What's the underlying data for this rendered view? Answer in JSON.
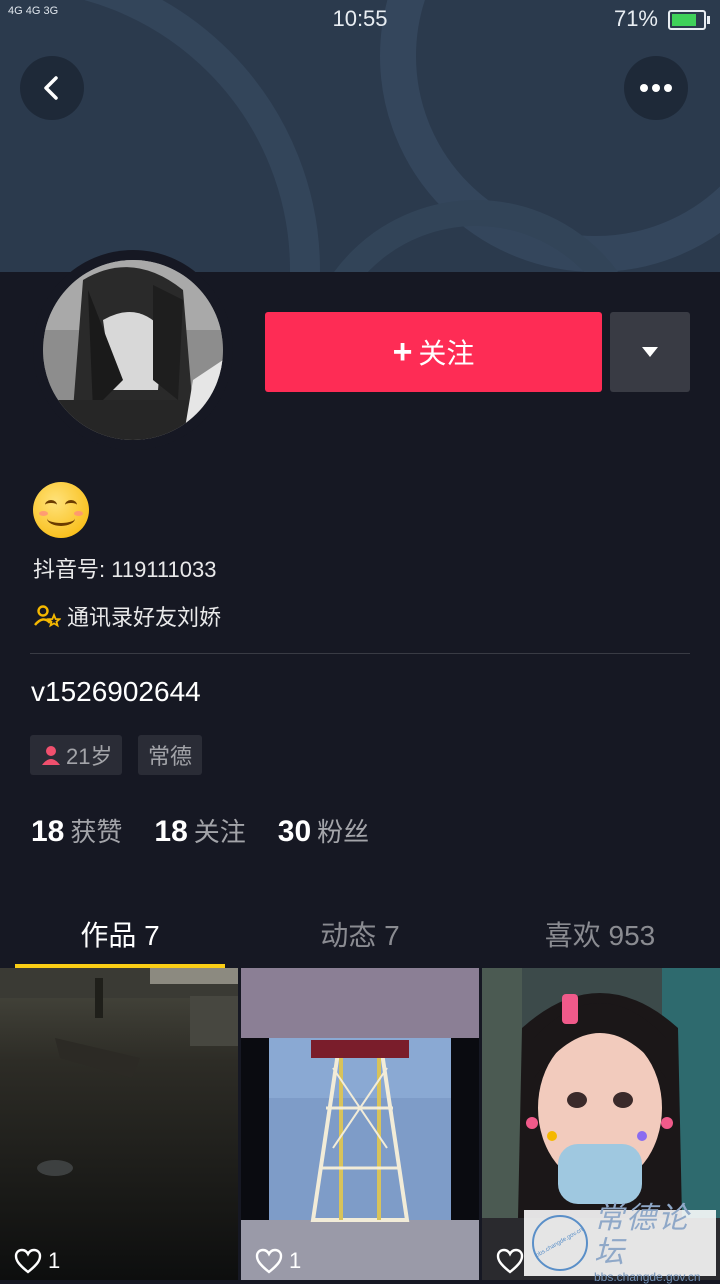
{
  "status_bar": {
    "signal": "4G 4G 3G",
    "time": "10:55",
    "battery": "71%"
  },
  "profile": {
    "douyin_id": "抖音号: 119111033",
    "friend_hint": "通讯录好友刘娇",
    "bio": "v1526902644",
    "tags": {
      "age": "21岁",
      "city": "常德"
    },
    "follow_button": "关注"
  },
  "stats": [
    {
      "num": "18",
      "label": "获赞"
    },
    {
      "num": "18",
      "label": "关注"
    },
    {
      "num": "30",
      "label": "粉丝"
    }
  ],
  "tabs": [
    {
      "label": "作品 7",
      "active": true
    },
    {
      "label": "动态 7",
      "active": false
    },
    {
      "label": "喜欢 953",
      "active": false
    }
  ],
  "videos": [
    {
      "likes": "1"
    },
    {
      "likes": "1"
    },
    {
      "likes": ""
    }
  ],
  "watermark": {
    "title": "常德论坛",
    "url": "bbs.changde.gov.cn",
    "seal_text": "bbs.changde.gov.cn"
  },
  "colors": {
    "accent": "#fe2c55",
    "background": "#161823",
    "tab_indicator": "#face15"
  },
  "icons": [
    "back-arrow-icon",
    "more-dots-icon",
    "dropdown-triangle-icon",
    "friends-icon",
    "gender-female-icon",
    "heart-icon",
    "smile-emoji-icon"
  ]
}
